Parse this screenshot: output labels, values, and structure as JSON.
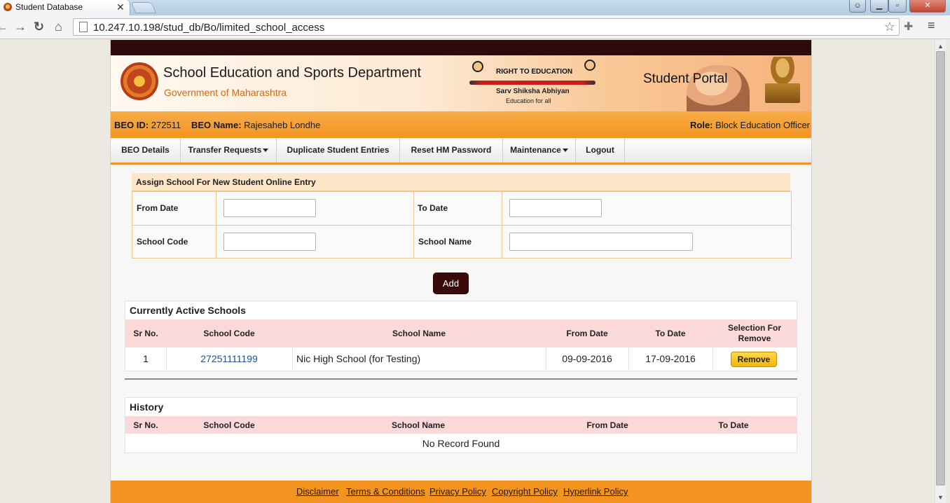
{
  "browser": {
    "tab_title": "Student Database",
    "tab_close": "✕",
    "url": "10.247.10.198/stud_db/Bo/limited_school_access",
    "icons": [
      "favicon-icon",
      "close-icon",
      "back-icon",
      "forward-icon",
      "reload-icon",
      "home-icon",
      "page-icon",
      "star-icon",
      "extension-icon",
      "menu-icon",
      "minimize-icon",
      "maximize-icon",
      "window-close-icon"
    ]
  },
  "header": {
    "department": "School Education and Sports Department",
    "government": "Government of Maharashtra",
    "rte_title": "RIGHT TO EDUCATION",
    "rte_sub": "Sarv Shiksha Abhiyan",
    "rte_tag": "Education for all",
    "portal": "Student Portal"
  },
  "info": {
    "beo_id_label": "BEO ID:",
    "beo_id": "272511",
    "beo_name_label": "BEO Name:",
    "beo_name": "Rajesaheb Londhe",
    "role_label": "Role:",
    "role": "Block Education Officer"
  },
  "nav": {
    "items": [
      {
        "label": "BEO Details"
      },
      {
        "label": "Transfer Requests"
      },
      {
        "label": "Duplicate Student Entries"
      },
      {
        "label": "Reset HM Password"
      },
      {
        "label": "Maintenance"
      },
      {
        "label": "Logout"
      }
    ]
  },
  "form": {
    "title": "Assign School For New Student Online Entry",
    "from_date_label": "From Date",
    "from_date_value": "",
    "to_date_label": "To Date",
    "to_date_value": "",
    "school_code_label": "School Code",
    "school_code_value": "",
    "school_name_label": "School Name",
    "school_name_value": "",
    "add_label": "Add"
  },
  "active": {
    "title": "Currently Active Schools",
    "columns": [
      "Sr No.",
      "School Code",
      "School Name",
      "From Date",
      "To Date",
      "Selection For Remove"
    ],
    "rows": [
      {
        "sr": "1",
        "code": "27251111199",
        "name": "Nic High School (for Testing)",
        "from": "09-09-2016",
        "to": "17-09-2016",
        "action": "Remove"
      }
    ]
  },
  "history": {
    "title": "History",
    "columns": [
      "Sr No.",
      "School Code",
      "School Name",
      "From Date",
      "To Date"
    ],
    "empty": "No Record Found"
  },
  "footer": {
    "links": [
      "Disclaimer",
      "Terms & Conditions",
      "Privacy Policy",
      "Copyright Policy",
      "Hyperlink Policy"
    ]
  },
  "colors": {
    "accent_orange": "#f39420",
    "dark_maroon": "#2e0a0a",
    "table_header_pink": "#fbd9d9",
    "remove_button_yellow": "#f2b70e"
  }
}
